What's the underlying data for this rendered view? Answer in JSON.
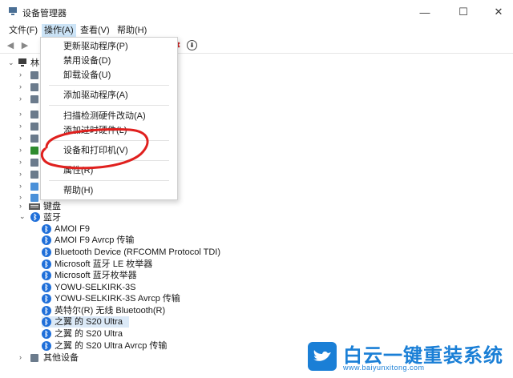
{
  "window": {
    "title": "设备管理器",
    "minimize": "—",
    "maximize": "☐",
    "close": "✕"
  },
  "menu": {
    "file": "文件(F)",
    "action": "操作(A)",
    "view": "查看(V)",
    "help": "帮助(H)"
  },
  "dropdown": {
    "items": [
      "更新驱动程序(P)",
      "禁用设备(D)",
      "卸载设备(U)",
      "添加驱动程序(A)",
      "扫描检测硬件改动(A)",
      "添加过时硬件(L)",
      "设备和打印机(V)",
      "属性(R)",
      "帮助(H)"
    ]
  },
  "tree": {
    "root_label": "林",
    "keyboard": "键盘",
    "bluetooth": "蓝牙",
    "other_devices": "其他设备",
    "bluetooth_devices": [
      "AMOI F9",
      "AMOI F9 Avrcp 传输",
      "Bluetooth Device (RFCOMM Protocol TDI)",
      "Microsoft 蓝牙 LE 枚举器",
      "Microsoft 蓝牙枚举器",
      "YOWU-SELKIRK-3S",
      "YOWU-SELKIRK-3S Avrcp 传输",
      "英特尔(R) 无线 Bluetooth(R)",
      "之翼 的 S20 Ultra",
      "之翼 的 S20 Ultra",
      "之翼 的 S20 Ultra Avrcp 传输"
    ]
  },
  "watermark": {
    "title": "白云一键重装系统",
    "url": "www.baiyunxitong.com"
  },
  "colors": {
    "accent": "#1a7fd6",
    "highlight": "#cce4f7",
    "annotation": "#e0201e"
  }
}
